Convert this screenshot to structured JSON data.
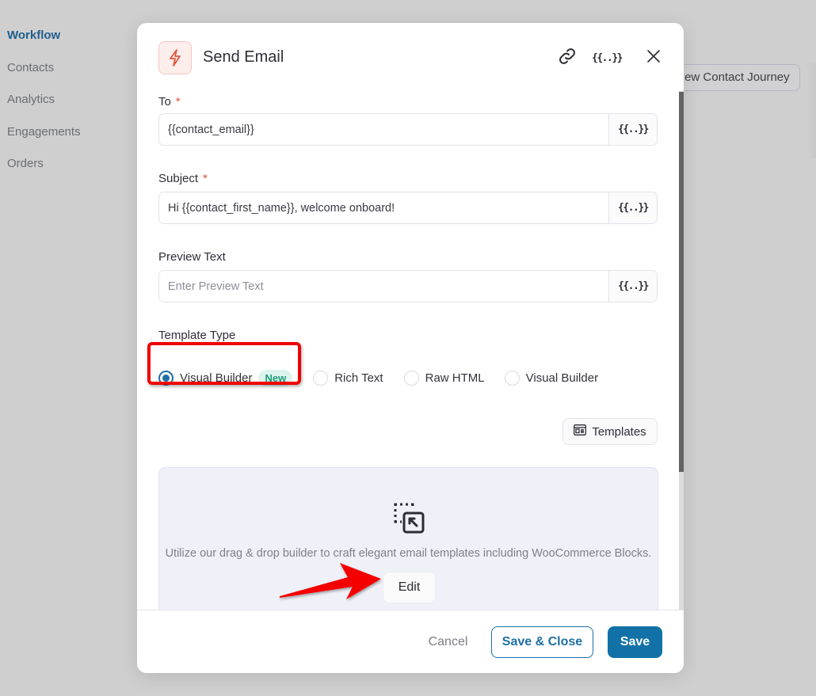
{
  "sidebar": {
    "items": [
      {
        "label": "Workflow",
        "active": true
      },
      {
        "label": "Contacts"
      },
      {
        "label": "Analytics"
      },
      {
        "label": "Engagements"
      },
      {
        "label": "Orders"
      }
    ]
  },
  "background": {
    "view_contact_journey_label": "View Contact Journey"
  },
  "modal": {
    "title": "Send Email",
    "header_icon": "lightning-bolt-icon",
    "header_actions": [
      {
        "name": "link-icon"
      },
      {
        "name": "merge-tags-icon",
        "glyph": "{{..}}"
      },
      {
        "name": "close-icon"
      }
    ],
    "merge_tag_glyph": "{{..}}",
    "required_mark": "*",
    "fields": {
      "to": {
        "label": "To",
        "required": true,
        "value": "{{contact_email}}",
        "placeholder": ""
      },
      "subject": {
        "label": "Subject",
        "required": true,
        "value": "Hi {{contact_first_name}}, welcome onboard!",
        "placeholder": ""
      },
      "preview_text": {
        "label": "Preview Text",
        "required": false,
        "value": "",
        "placeholder": "Enter Preview Text"
      }
    },
    "template_type": {
      "label": "Template Type",
      "options": [
        {
          "label": "Visual Builder",
          "badge": "New",
          "checked": true
        },
        {
          "label": "Rich Text",
          "checked": false
        },
        {
          "label": "Raw HTML",
          "checked": false
        },
        {
          "label": "Visual Builder",
          "checked": false
        }
      ]
    },
    "templates_button": "Templates",
    "builder": {
      "icon": "drag-drop-builder-icon",
      "description": "Utilize our drag & drop builder to craft elegant email templates including WooCommerce Blocks.",
      "edit_label": "Edit"
    },
    "footer": {
      "cancel_label": "Cancel",
      "save_close_label": "Save & Close",
      "save_label": "Save"
    }
  },
  "colors": {
    "primary": "#1272a8",
    "accent_outline": "#1f6fa5",
    "required": "#e0533d",
    "badge_bg": "#dff3ee",
    "badge_text": "#1b9c7e",
    "annotation_red": "#f00000",
    "overlay": "#cfcfd0"
  }
}
